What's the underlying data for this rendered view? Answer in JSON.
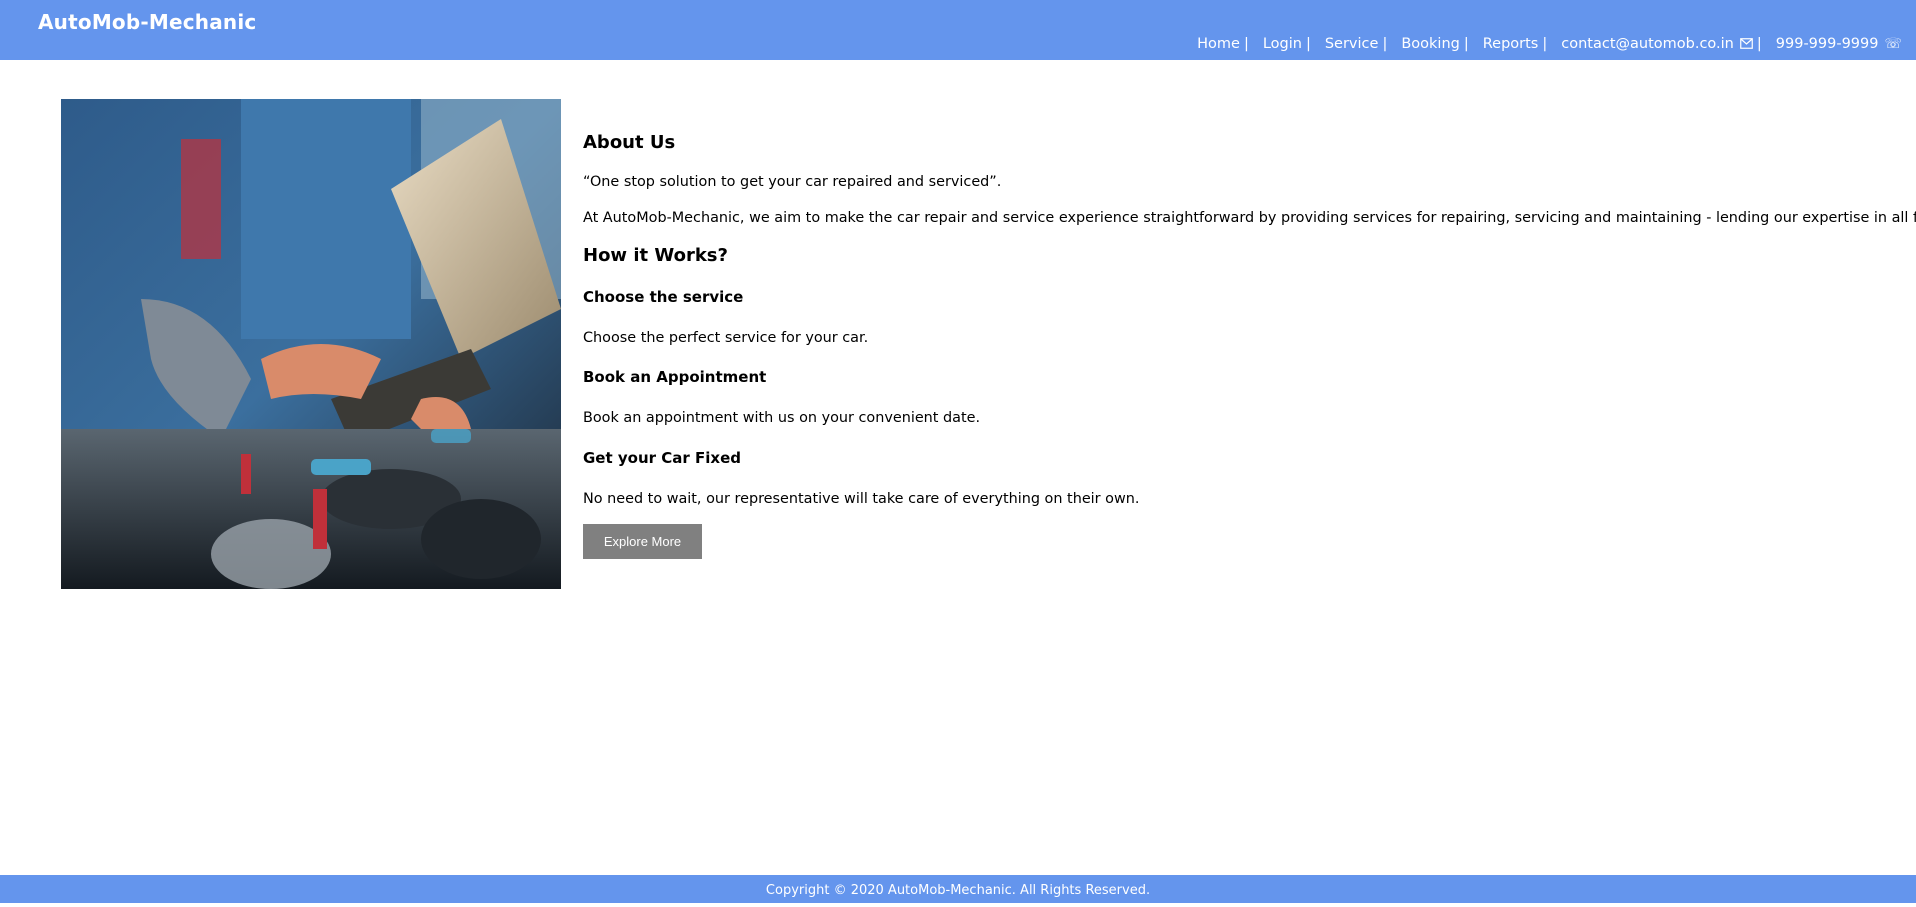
{
  "header": {
    "brand": "AutoMob-Mechanic",
    "nav": {
      "home": "Home",
      "login": "Login",
      "service": "Service",
      "booking": "Booking",
      "reports": "Reports",
      "email": "contact@automob.co.in",
      "phone": "999-999-9999",
      "separator": "|"
    },
    "icons": {
      "email_icon": "envelope-icon",
      "phone_icon": "telephone-icon"
    }
  },
  "main": {
    "image": "mechanic-with-laptop-photo",
    "about_title": "About Us",
    "quote": "“One stop solution to get your car repaired and serviced”.",
    "about_text": "At AutoMob-Mechanic, we aim to make the car repair and service experience straightforward by providing services for repairing, servicing and maintaining - lending our expertise in all forms.",
    "how_title": "How it Works?",
    "steps": [
      {
        "title": "Choose the service",
        "text": "Choose the perfect service for your car."
      },
      {
        "title": "Book an Appointment",
        "text": "Book an appointment with us on your convenient date."
      },
      {
        "title": "Get your Car Fixed",
        "text": "No need to wait, our representative will take care of everything on their own."
      }
    ],
    "explore_button": "Explore More"
  },
  "footer": {
    "copyright": "Copyright © 2020 AutoMob-Mechanic.  All Rights Reserved."
  },
  "colors": {
    "header_bg": "#6495ed",
    "button_bg": "#808080",
    "text": "#000000"
  }
}
